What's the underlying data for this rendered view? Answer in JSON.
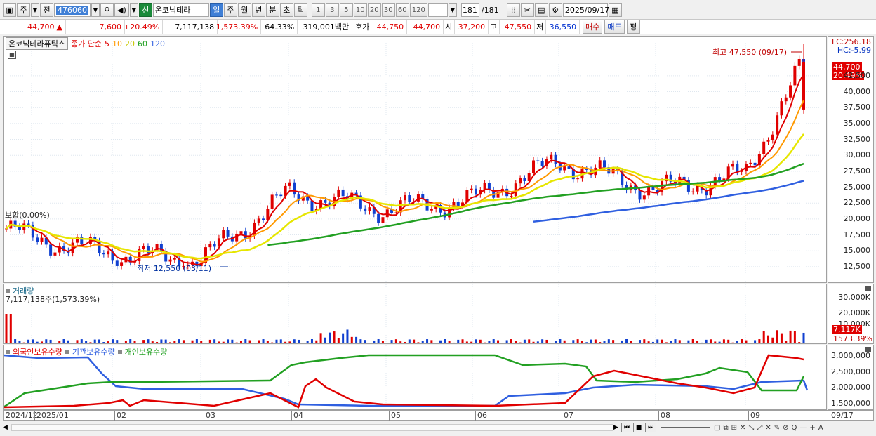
{
  "toolbar": {
    "market_label": "주",
    "prev_label": "전",
    "stock_code": "476060",
    "stock_type_badge": "신",
    "stock_name": "온코닉테라",
    "periods": [
      "일",
      "주",
      "월",
      "년",
      "분",
      "초",
      "틱"
    ],
    "intervals": [
      "1",
      "3",
      "5",
      "10",
      "20",
      "30",
      "60",
      "120"
    ],
    "count_value": "181",
    "count_total": "/181",
    "date": "2025/09/17"
  },
  "quote": {
    "price": "44,700",
    "change_arrow": "▲",
    "change": "7,600",
    "change_pct": "+20.49%",
    "volume": "7,117,138",
    "volume_pct": "1,573.39%",
    "turnover": "64.33%",
    "amount": "319,001백만",
    "bid_label": "호가",
    "bid": "44,750",
    "ask": "44,700",
    "open_label": "시",
    "open": "37,200",
    "high_label": "고",
    "high": "47,550",
    "low_label": "저",
    "low": "36,550",
    "buy_label": "매수",
    "sell_label": "매도",
    "flat_label": "평"
  },
  "price_pane": {
    "stock_title": "온코닉테라퓨틱스",
    "ma_label": "종가 단순",
    "ma_periods": [
      {
        "label": "5",
        "color": "#e00000"
      },
      {
        "label": "10",
        "color": "#ff9900"
      },
      {
        "label": "20",
        "color": "#e6e600"
      },
      {
        "label": "60",
        "color": "#22a022"
      },
      {
        "label": "120",
        "color": "#2f5fe0"
      }
    ],
    "lc": "LC:256.18",
    "hc": "HC:-5.99",
    "current_price_tag": "44,700",
    "current_pct_tag": "20.49%",
    "high_note": "최고 47,550 (09/17)",
    "low_note": "최저 12,550 (03/11)",
    "flat_note": "보합(0.00%)",
    "y_ticks": [
      "42,500",
      "40,000",
      "37,500",
      "35,000",
      "32,500",
      "30,000",
      "27,500",
      "25,000",
      "22,500",
      "20,000",
      "17,500",
      "15,000",
      "12,500"
    ]
  },
  "volume_pane": {
    "title": "거래량",
    "value_note": "7,117,138주(1,573.39%)",
    "y_ticks": [
      "30,000K",
      "20,000K",
      "10,000K"
    ],
    "current_tag": "7,117K",
    "current_pct_tag": "1573.39%"
  },
  "holding_pane": {
    "series": [
      {
        "label": "외국인보유수량",
        "color": "#e00000"
      },
      {
        "label": "기관보유수량",
        "color": "#2f5fe0"
      },
      {
        "label": "개인보유수량",
        "color": "#22a022"
      }
    ],
    "y_ticks": [
      "3,000,000",
      "2,500,000",
      "2,000,000",
      "1,500,000"
    ]
  },
  "x_axis": {
    "labels": [
      "2024/12",
      "2025/01",
      "02",
      "03",
      "04",
      "05",
      "06",
      "07",
      "08",
      "09",
      "09/17"
    ]
  },
  "chart_data": {
    "type": "candlestick",
    "y_range": [
      10500,
      48000
    ],
    "ohlc_approx": [
      {
        "x": "2024/12",
        "close": 18500
      },
      {
        "x": "2025/01",
        "close": 17000
      },
      {
        "x": "02",
        "close": 14500
      },
      {
        "x": "03",
        "close": 13500
      },
      {
        "x": "04",
        "close": 24000
      },
      {
        "x": "05",
        "close": 21500
      },
      {
        "x": "06",
        "close": 23000
      },
      {
        "x": "07",
        "close": 29000
      },
      {
        "x": "08",
        "close": 24500
      },
      {
        "x": "09",
        "close": 27000
      },
      {
        "x": "09/17",
        "open": 37200,
        "high": 47550,
        "low": 36550,
        "close": 44700
      }
    ]
  }
}
